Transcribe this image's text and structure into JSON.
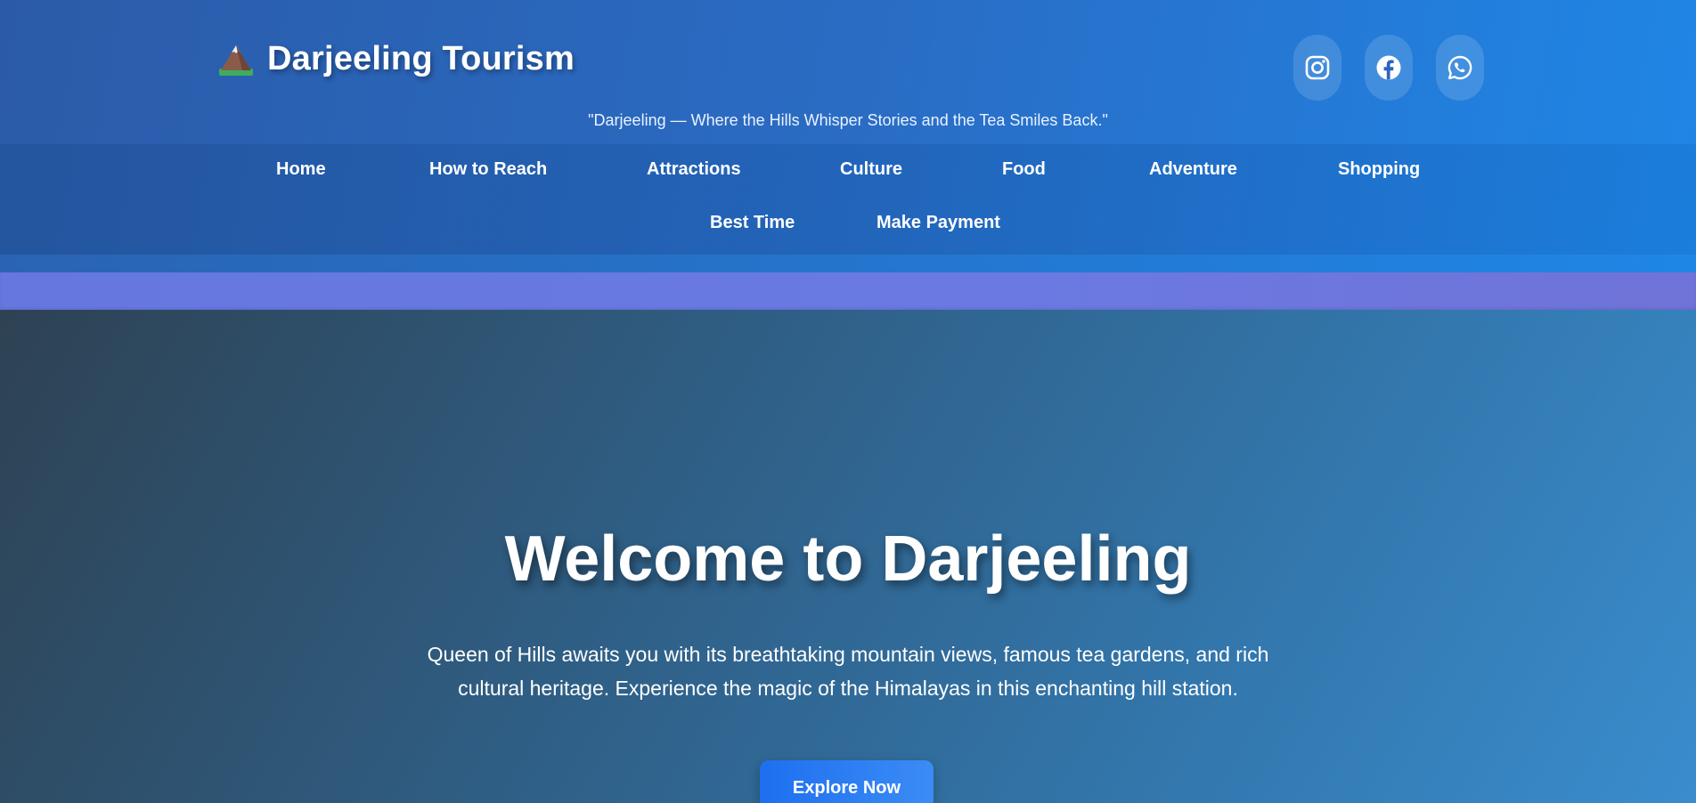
{
  "header": {
    "brand_icon": "mountain-icon",
    "title": "Darjeeling Tourism",
    "tagline": "\"Darjeeling — Where the Hills Whisper Stories and the Tea Smiles Back.\"",
    "social": [
      {
        "icon": "instagram-icon",
        "label": "Instagram"
      },
      {
        "icon": "facebook-icon",
        "label": "Facebook"
      },
      {
        "icon": "whatsapp-icon",
        "label": "WhatsApp"
      }
    ]
  },
  "nav": {
    "items": [
      {
        "label": "Home"
      },
      {
        "label": "How to Reach"
      },
      {
        "label": "Attractions"
      },
      {
        "label": "Culture"
      },
      {
        "label": "Food"
      },
      {
        "label": "Adventure"
      },
      {
        "label": "Shopping"
      },
      {
        "label": "Best Time"
      },
      {
        "label": "Make Payment"
      }
    ]
  },
  "hero": {
    "title": "Welcome to Darjeeling",
    "description": "Queen of Hills awaits you with its breathtaking mountain views, famous tea gardens, and rich cultural heritage. Experience the magic of the Himalayas in this enchanting hill station.",
    "cta_label": "Explore Now"
  },
  "colors": {
    "header_start": "#2b5ba8",
    "header_end": "#1f86e6",
    "band": "#6677e0",
    "hero_dark": "#2e4253",
    "hero_light": "#3a8ccd",
    "cta": "#1e6ff0"
  }
}
